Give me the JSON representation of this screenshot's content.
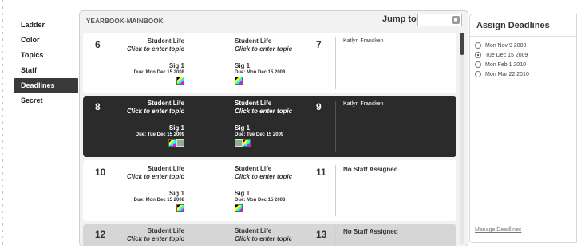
{
  "nav": {
    "items": [
      {
        "label": "Ladder",
        "active": false
      },
      {
        "label": "Color",
        "active": false
      },
      {
        "label": "Topics",
        "active": false
      },
      {
        "label": "Staff",
        "active": false
      },
      {
        "label": "Deadlines",
        "active": true
      },
      {
        "label": "Secret",
        "active": false
      }
    ]
  },
  "header": {
    "book_title": "YEARBOOK-MAINBOOK",
    "jump_label": "Jump to",
    "jump_value": ""
  },
  "spreads": [
    {
      "left_page": "6",
      "right_page": "7",
      "state": "normal",
      "left": {
        "section": "Student Life",
        "topic": "Click to enter topic",
        "sig": "Sig 1",
        "due": "Due: Mon Dec 15 2008",
        "thumbs": [
          "cmyk"
        ]
      },
      "right": {
        "section": "Student Life",
        "topic": "Click to enter topic",
        "sig": "Sig 1",
        "due": "Due: Mon Dec 15 2008",
        "thumbs": [
          "cmyk"
        ]
      },
      "staff": "Katlyn Francken",
      "staff_bold": false
    },
    {
      "left_page": "8",
      "right_page": "9",
      "state": "selected",
      "left": {
        "section": "Student Life",
        "topic": "Click to enter topic",
        "sig": "Sig 1",
        "due": "Due: Tue Dec 15 2009",
        "thumbs": [
          "cmyk",
          "green"
        ]
      },
      "right": {
        "section": "Student Life",
        "topic": "Click to enter topic",
        "sig": "Sig 1",
        "due": "Due: Tue Dec 15 2009",
        "thumbs": [
          "green",
          "cmyk"
        ]
      },
      "staff": "Katlyn Francken",
      "staff_bold": false
    },
    {
      "left_page": "10",
      "right_page": "11",
      "state": "normal",
      "left": {
        "section": "Student Life",
        "topic": "Click to enter topic",
        "sig": "Sig 1",
        "due": "Due: Mon Dec 15 2008",
        "thumbs": [
          "cmyk"
        ]
      },
      "right": {
        "section": "Student Life",
        "topic": "Click to enter topic",
        "sig": "Sig 1",
        "due": "Due: Mon Dec 15 2008",
        "thumbs": [
          "cmyk"
        ]
      },
      "staff": "No Staff Assigned",
      "staff_bold": true
    },
    {
      "left_page": "12",
      "right_page": "13",
      "state": "dim",
      "left": {
        "section": "Student Life",
        "topic": "Click to enter topic"
      },
      "right": {
        "section": "Student Life",
        "topic": "Click to enter topic"
      },
      "staff": "No Staff Assigned",
      "staff_bold": true
    }
  ],
  "deadlines": {
    "title": "Assign Deadlines",
    "options": [
      {
        "label": "Mon Nov 9 2009",
        "selected": false
      },
      {
        "label": "Tue Dec 15 2009",
        "selected": true
      },
      {
        "label": "Mon Feb 1 2010",
        "selected": false
      },
      {
        "label": "Mon Mar 22 2010",
        "selected": false
      }
    ],
    "manage_link": "Manage Deadlines"
  }
}
